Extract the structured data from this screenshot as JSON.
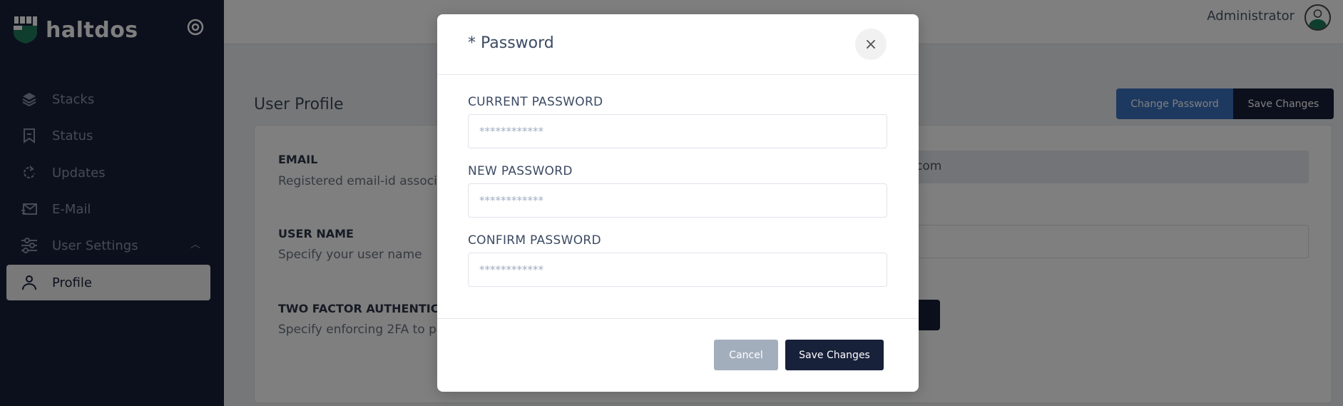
{
  "brand": {
    "name": "haltdos",
    "logo_color": "#1f7a5c"
  },
  "sidebar": {
    "items": [
      {
        "label": "Stacks",
        "icon": "layers-icon"
      },
      {
        "label": "Status",
        "icon": "bookmark-icon"
      },
      {
        "label": "Updates",
        "icon": "refresh-icon"
      },
      {
        "label": "E-Mail",
        "icon": "mail-icon"
      },
      {
        "label": "User Settings",
        "icon": "sliders-icon"
      },
      {
        "label": "Profile",
        "icon": "user-icon",
        "active": true
      }
    ]
  },
  "header": {
    "user": "Administrator"
  },
  "page": {
    "title": "User Profile",
    "change_password": "Change Password",
    "save_changes": "Save Changes",
    "fields": [
      {
        "label": "EMAIL",
        "desc": "Registered email-id associ",
        "value": "com"
      },
      {
        "label": "USER NAME",
        "desc": "Specify your user name"
      },
      {
        "label": "TWO FACTOR AUTHENTIC",
        "desc": "Specify enforcing 2FA to p"
      }
    ]
  },
  "modal": {
    "title": "* Password",
    "close": "×",
    "fields": [
      {
        "label": "CURRENT PASSWORD",
        "placeholder": "************"
      },
      {
        "label": "NEW PASSWORD",
        "placeholder": "************"
      },
      {
        "label": "CONFIRM PASSWORD",
        "placeholder": "************"
      }
    ],
    "cancel": "Cancel",
    "save": "Save Changes"
  },
  "colors": {
    "sidebar": "#18213a",
    "primary": "#3b73c0",
    "dark": "#18213a",
    "cancel": "#a3aebd"
  }
}
